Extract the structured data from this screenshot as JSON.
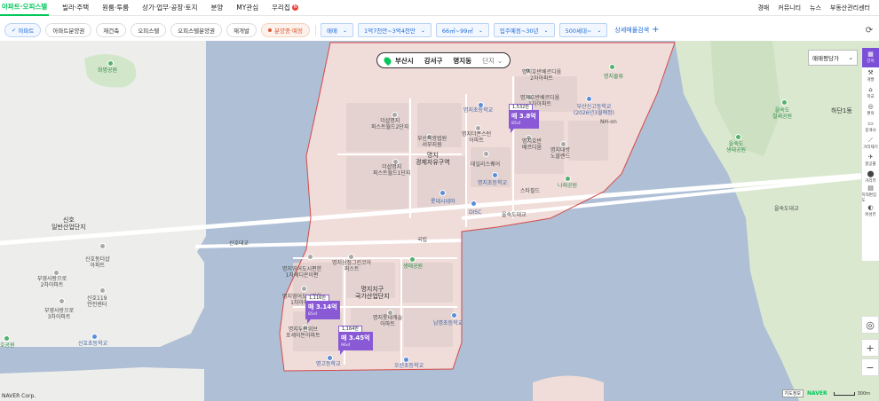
{
  "topnav": {
    "items": [
      "아파트·오피스텔",
      "빌라·주택",
      "원룸·투룸",
      "상가·업무·공장·토지",
      "분양",
      "MY관심",
      "우리집"
    ],
    "new_badge": "N",
    "right": [
      "경매",
      "커뮤니티",
      "뉴스",
      "부동산관리센터"
    ]
  },
  "filters": {
    "chips": [
      "아파트",
      "아파트분양권",
      "재건축",
      "오피스텔",
      "오피스텔분양권",
      "재개발",
      "분양중·예정"
    ],
    "selects": [
      "매매",
      "1억7천만~3억4천만",
      "66㎡~99㎡",
      "입주예정~30년",
      "500세대~"
    ],
    "detail_search": "상세매물검색",
    "detail_plus": "+"
  },
  "location": {
    "city": "부산시",
    "district": "강서구",
    "dong": "명지동",
    "unit": "단지"
  },
  "sort_select": {
    "value": "매매평당가",
    "chev": "⌄"
  },
  "markers": [
    {
      "count": "1,532만",
      "price": "매 3.8억",
      "area": "85㎡"
    },
    {
      "count": "1,116만",
      "price": "매 3.14억",
      "area": "85㎡"
    },
    {
      "count": "1,164만",
      "price": "매 3.45억",
      "area": "96㎡"
    }
  ],
  "labels": {
    "hwamyeong_park": "화명공원",
    "sinho_industrial": "신호\n일반산업단지",
    "sinho_bridge": "신호대교",
    "sinho_dorimanji": "신호동더샵\n아파트",
    "buyeong_2": "부영사랑으로\n2차아파트",
    "sinho_119": "신호119\n안전센터",
    "buyeong_3": "부영사랑으로\n3차아파트",
    "sinho_school": "신호초등학교",
    "hoje_park": "호공원",
    "myeongji_econ": "명지\n경제자유구역",
    "theshop_2": "더샵명지\n퍼스트월드2단지",
    "theshop_1": "더샵명지\n퍼스트월드1단지",
    "busan_court": "부산지방법원\n서부지원",
    "myeongji_starsand": "명지더폰스턴\n아파트",
    "daily_square": "데일리스퀘어",
    "lotte_mart": "롯데시네마",
    "disc": "DISC",
    "myeongji_elem": "명지초등학교",
    "hoban_1": "명지호반베르디움\n2차아파트",
    "hoban_first": "명지호반베르디움\n1차아파트",
    "busan_high_pier": "부산신고등학교\n(2026년3월예정)",
    "dong_nhr": "NH-on",
    "hoban_verdium": "명지호반\n베르디움",
    "myeongji_daewoo": "명지대방\n노블랜드",
    "eulsuk_bridge": "을숙도대교",
    "starbucks": "스타필드",
    "narae_park": "나래공원",
    "myeongji_mid": "명지중학교",
    "gunbongbo": "국립",
    "myeongji_edu": "명지학교",
    "dacheng_park": "명지초등학교",
    "myeongji_industrial": "명지지구\n국가산업단지",
    "oseon_park": "생태공원",
    "ohyeon_1": "명지영어도시편한\n1차에디온이편",
    "ohyeon_park": "명지삼정그린코아\n퍼스트",
    "myeongji_lotte": "명지롯데캐슬\n아파트",
    "ohyeon_2": "명지영어도시편한\n1차아파트",
    "myeongji_cheon": "명지두산위브\n포세이돈아파트",
    "namyeong_school": "남명초등학교",
    "myeongji_high": "명고등학교",
    "oseon_school": "오션초등학교",
    "hadan": "하단1동",
    "eulsukdo_park": "을숙도\n철새공원",
    "eulsukdo_eco": "을숙도\n생태공원",
    "eulsukdo_bridge2": "을숙도대교",
    "ulsuk_park": "을숙도공원",
    "myeongji_cloud": "명지물류",
    "eco_park": "생태공원",
    "ewha_park": "명지근린공원"
  },
  "rail": {
    "tools": [
      "단지",
      "개발",
      "학교",
      "편의",
      "중개사",
      "거리재기",
      "향공률",
      "거리뷰",
      "지적편집도",
      "위성뷰"
    ]
  },
  "zoom": {
    "locate": "◎",
    "plus": "+",
    "minus": "−"
  },
  "footer": {
    "corp": "NAVER Corp.",
    "nav_label": "지도정보",
    "logo": "NAVER",
    "scale": "300m"
  },
  "colors": {
    "accent": "#03c75a",
    "marker": "#8a5ad6",
    "selector": "#1a6ad8"
  }
}
